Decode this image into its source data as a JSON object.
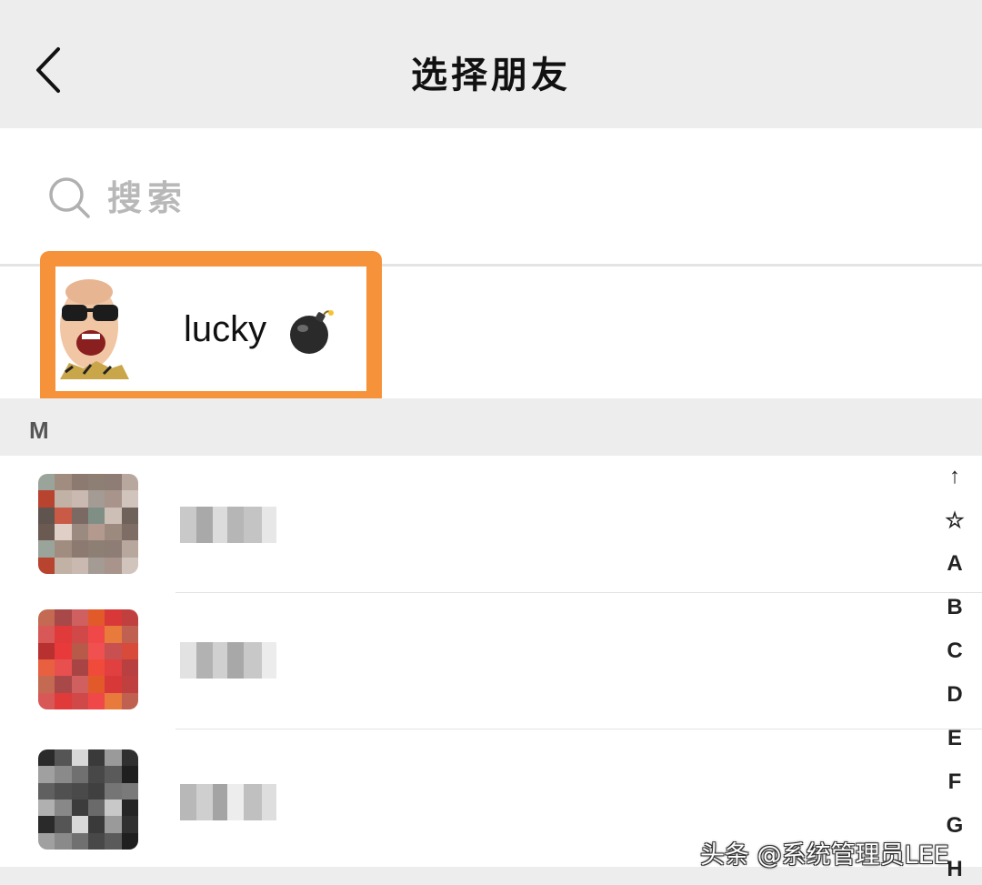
{
  "header": {
    "title": "选择朋友",
    "back_icon": "chevron-left-icon"
  },
  "search": {
    "placeholder": "搜索",
    "icon": "search-icon"
  },
  "selected": {
    "name": "lucky",
    "emoji_icon": "bomb-icon",
    "highlight_color": "#f5923a"
  },
  "section": {
    "letter": "M"
  },
  "contacts": [
    {
      "name_pixelated": true
    },
    {
      "name_pixelated": true
    },
    {
      "name_pixelated": true
    }
  ],
  "index_bar": [
    "↑",
    "☆",
    "A",
    "B",
    "C",
    "D",
    "E",
    "F",
    "G",
    "H"
  ],
  "watermark": "头条 @系统管理员LEE",
  "colors": {
    "header_bg": "#ededed",
    "section_bg": "#ededed",
    "highlight": "#f5923a"
  }
}
